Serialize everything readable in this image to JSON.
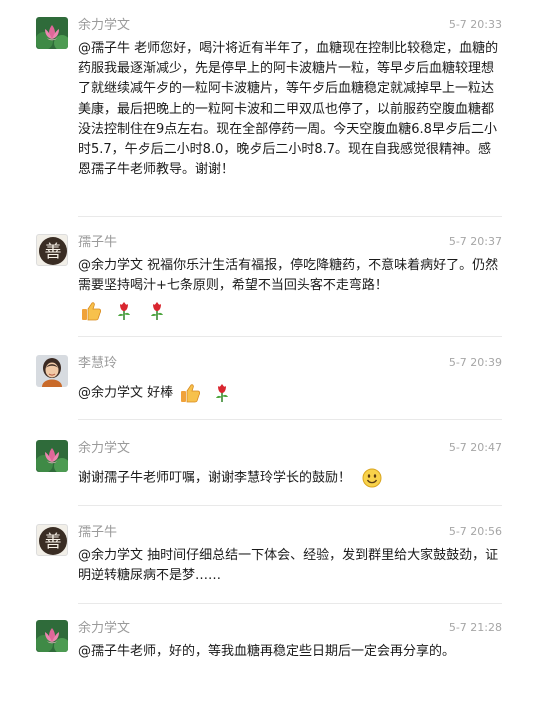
{
  "messages": [
    {
      "name": "余力学文",
      "time": "5-7 20:33",
      "avatar_icon": "lotus-flower-icon",
      "text": "@孺子牛 老师您好，喝汁将近有半年了，血糖现在控制比较稳定，血糖的药服我最逐渐减少，先是停早上的阿卡波糖片一粒，等早歺后血糖较理想了就继续减午歺的一粒阿卡波糖片，等午歺后血糖稳定就减掉早上一粒达美康，最后把晚上的一粒阿卡波和二甲双瓜也停了，以前服药空腹血糖都没法控制住在9点左右。现在全部停药一周。今天空腹血糖6.8早歺后二小时5.7，午歺后二小时8.0，晚歺后二小时8.7。现在自我感觉很精神。感恩孺子牛老师教导。谢谢！"
    },
    {
      "name": "孺子牛",
      "time": "5-7 20:37",
      "avatar_icon": "calligraphy-character-icon",
      "avatar_text": "善",
      "text": "@余力学文 祝福你乐汁生活有福报，停吃降糖药，不意味着病好了。仍然需要坚持喝汁+七条原则，希望不当回头客不走弯路！",
      "emojis": [
        "thumbs-up-icon",
        "rose-icon",
        "rose-icon"
      ]
    },
    {
      "name": "李慧玲",
      "time": "5-7 20:39",
      "avatar_icon": "user-photo-icon",
      "text": "@余力学文 好棒",
      "emojis": [
        "thumbs-up-icon",
        "rose-icon"
      ]
    },
    {
      "name": "余力学文",
      "time": "5-7 20:47",
      "avatar_icon": "lotus-flower-icon",
      "text": "谢谢孺子牛老师叮嘱，谢谢李慧玲学长的鼓励！",
      "emojis": [
        "smile-face-icon"
      ]
    },
    {
      "name": "孺子牛",
      "time": "5-7 20:56",
      "avatar_icon": "calligraphy-character-icon",
      "avatar_text": "善",
      "text": "@余力学文 抽时间仔细总结一下体会、经验，发到群里给大家鼓鼓劲，证明逆转糖尿病不是梦……"
    },
    {
      "name": "余力学文",
      "time": "5-7 21:28",
      "avatar_icon": "lotus-flower-icon",
      "text": "@孺子牛老师，好的，等我血糖再稳定些日期后一定会再分享的。"
    }
  ]
}
